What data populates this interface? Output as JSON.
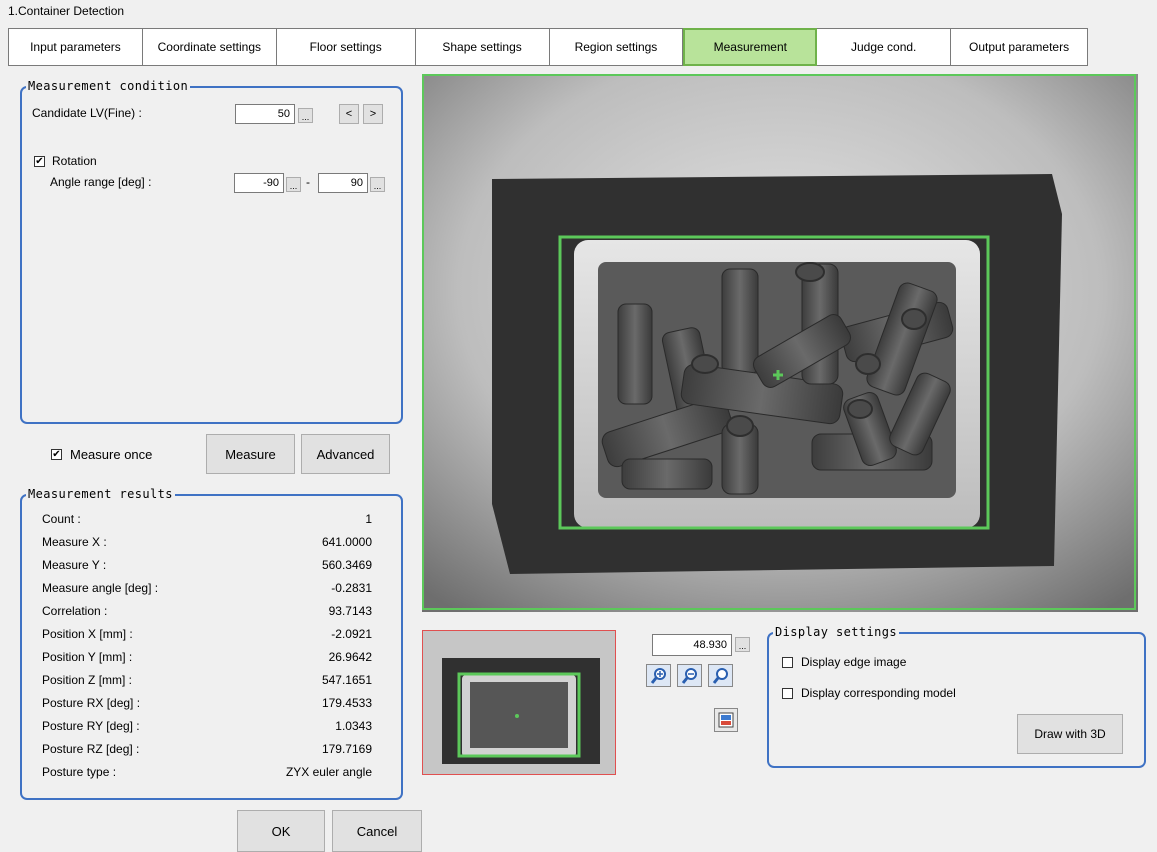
{
  "window_title": "1.Container Detection",
  "tabs": [
    {
      "label": "Input parameters"
    },
    {
      "label": "Coordinate settings"
    },
    {
      "label": "Floor settings"
    },
    {
      "label": "Shape settings"
    },
    {
      "label": "Region settings"
    },
    {
      "label": "Measurement",
      "active": true
    },
    {
      "label": "Judge cond."
    },
    {
      "label": "Output parameters"
    }
  ],
  "measurement_condition": {
    "legend": "Measurement condition",
    "candidate_label": "Candidate LV(Fine) :",
    "candidate_value": "50",
    "dots": "...",
    "prev_label": "<",
    "next_label": ">",
    "rotation_label": "Rotation",
    "rotation_checked": true,
    "angle_label": "Angle range [deg] :",
    "angle_min": "-90",
    "angle_dash": "-",
    "angle_max": "90"
  },
  "measure_once_label": "Measure once",
  "measure_button": "Measure",
  "advanced_button": "Advanced",
  "measurement_results": {
    "legend": "Measurement results",
    "rows": [
      {
        "label": "Count :",
        "value": "1"
      },
      {
        "label": "Measure X :",
        "value": "641.0000"
      },
      {
        "label": "Measure Y :",
        "value": "560.3469"
      },
      {
        "label": "Measure angle [deg] :",
        "value": "-0.2831"
      },
      {
        "label": "Correlation :",
        "value": "93.7143"
      },
      {
        "label": "Position X [mm] :",
        "value": "-2.0921"
      },
      {
        "label": "Position Y [mm] :",
        "value": "26.9642"
      },
      {
        "label": "Position Z [mm] :",
        "value": "547.1651"
      },
      {
        "label": "Posture RX [deg] :",
        "value": "179.4533"
      },
      {
        "label": "Posture RY [deg] :",
        "value": "1.0343"
      },
      {
        "label": "Posture RZ [deg] :",
        "value": "179.7169"
      },
      {
        "label": "Posture type :",
        "value": "ZYX euler angle"
      }
    ]
  },
  "ok_button": "OK",
  "cancel_button": "Cancel",
  "zoom_value": "48.930",
  "display_settings": {
    "legend": "Display settings",
    "edge_label": "Display edge image",
    "model_label": "Display corresponding model",
    "draw3d_button": "Draw with 3D"
  },
  "colors": {
    "accent": "#3f72c4",
    "active_tab": "#b8e39a",
    "detection_box": "#5cc85a"
  }
}
